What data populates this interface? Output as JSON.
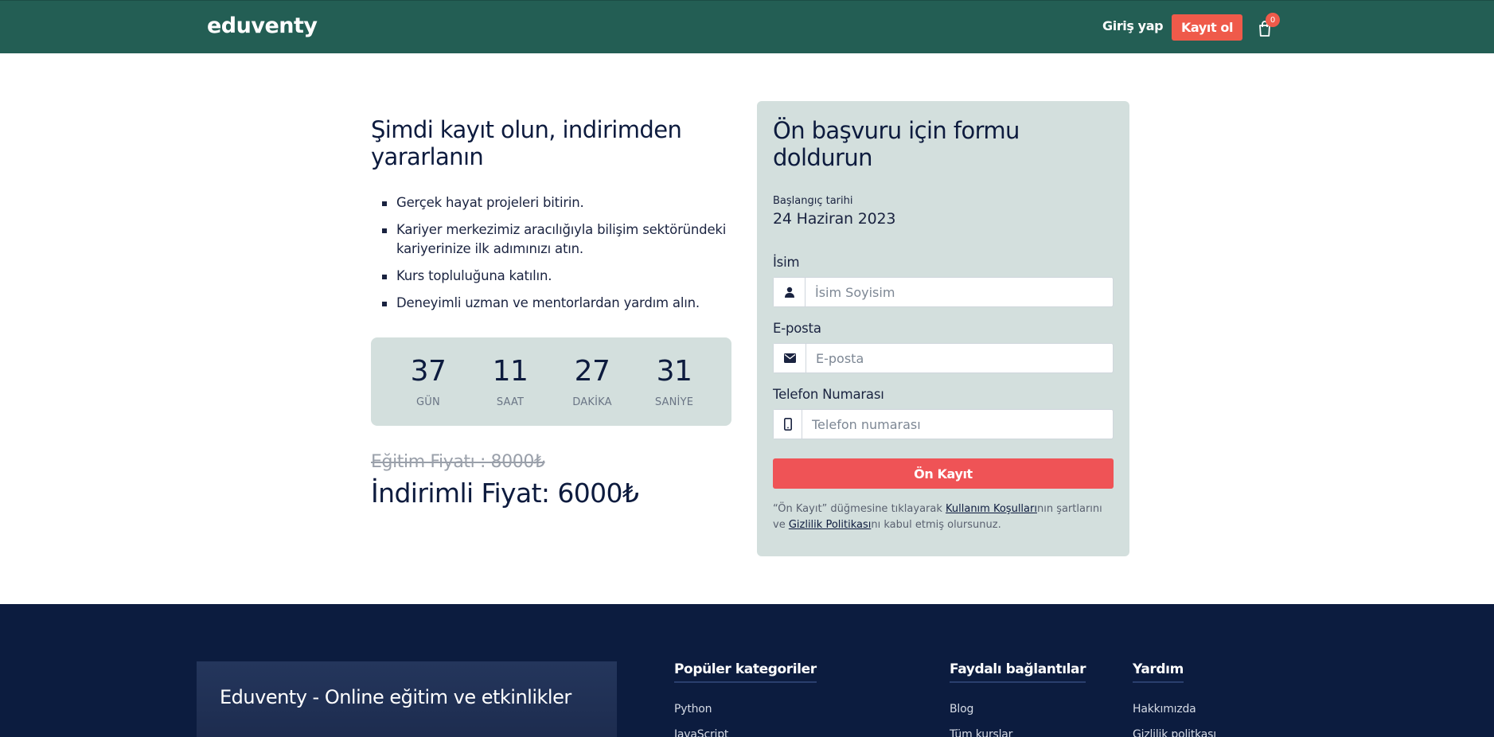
{
  "header": {
    "logo": "eduventy",
    "login_label": "Giriş yap",
    "signup_label": "Kayıt ol",
    "cart_count": "0"
  },
  "left": {
    "title": "Şimdi kayıt olun, indirimden yararlanın",
    "features": [
      "Gerçek hayat projeleri bitirin.",
      "Kariyer merkezimiz aracılığıyla bilişim sektöründeki kariyerinize ilk adımınızı atın.",
      "Kurs topluluğuna katılın.",
      "Deneyimli uzman ve mentorlardan yardım alın."
    ],
    "countdown": [
      {
        "value": "37",
        "label": "GÜN"
      },
      {
        "value": "11",
        "label": "SAAT"
      },
      {
        "value": "27",
        "label": "DAKİKA"
      },
      {
        "value": "31",
        "label": "SANİYE"
      }
    ],
    "old_price": "Eğitim Fiyatı : 8000₺",
    "new_price": "İndirimli Fiyat: 6000₺"
  },
  "form": {
    "title": "Ön başvuru için formu doldurun",
    "start_label": "Başlangıç tarihi",
    "start_date": "24 Haziran 2023",
    "name_label": "İsim",
    "name_placeholder": "İsim Soyisim",
    "email_label": "E-posta",
    "email_placeholder": "E-posta",
    "phone_label": "Telefon Numarası",
    "phone_placeholder": "Telefon numarası",
    "submit_label": "Ön Kayıt",
    "terms_prefix": "“Ön Kayıt” düğmesine tıklayarak ",
    "terms_link": "Kullanım Koşulları",
    "terms_middle": "nın şartlarını ve ",
    "privacy_link": "Gizlilik Politikası",
    "terms_suffix": "nı kabul etmiş olursunuz."
  },
  "footer": {
    "box_title": "Eduventy - Online eğitim ve etkinlikler",
    "columns": [
      {
        "title": "Popüler kategoriler",
        "links": [
          "Python",
          "JavaScript"
        ]
      },
      {
        "title": "Faydalı bağlantılar",
        "links": [
          "Blog",
          "Tüm kurslar"
        ]
      },
      {
        "title": "Yardım",
        "links": [
          "Hakkımızda",
          "Gizlilik politkası"
        ]
      }
    ]
  },
  "colors": {
    "header_bg": "#235e54",
    "accent": "#ef5a4a",
    "card_bg": "#d3dfdd",
    "footer_bg": "#0c1c3f"
  }
}
